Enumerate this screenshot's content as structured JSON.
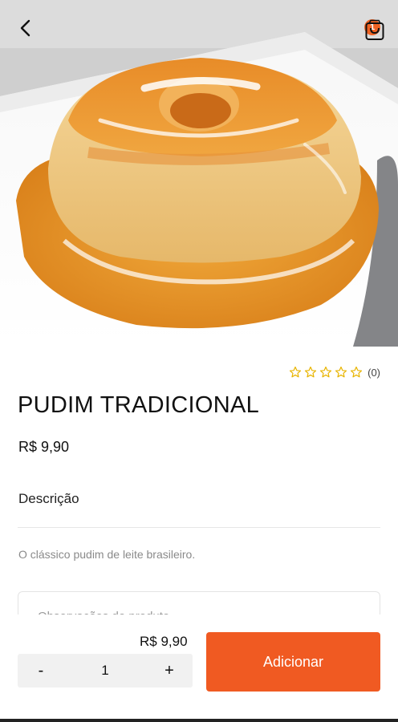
{
  "product": {
    "name": "PUDIM TRADICIONAL",
    "price": "R$ 9,90",
    "rating_count": "(0)",
    "rating_stars": 0,
    "description_label": "Descrição",
    "description": "O clássico pudim de leite brasileiro.",
    "notes_placeholder": "Observações do produto"
  },
  "header": {
    "cart_count": "1"
  },
  "footer": {
    "subtotal": "R$ 9,90",
    "quantity": "1",
    "minus_label": "-",
    "plus_label": "+",
    "add_label": "Adicionar"
  },
  "colors": {
    "accent": "#f05a22",
    "badge": "#f06323",
    "star": "#e8b400"
  }
}
